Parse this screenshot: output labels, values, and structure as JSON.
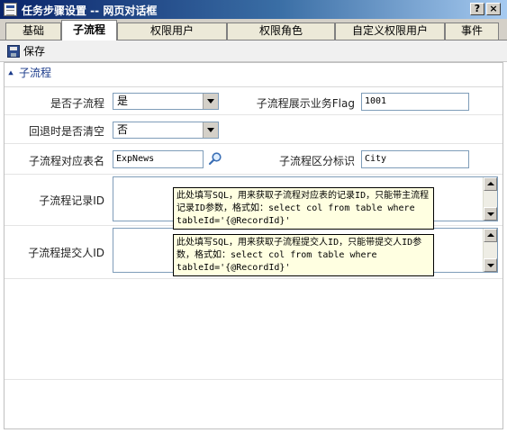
{
  "window": {
    "title": "任务步骤设置 -- 网页对话框",
    "help_label": "?",
    "close_label": "×"
  },
  "tabs": [
    {
      "label": "基础",
      "active": false
    },
    {
      "label": "子流程",
      "active": true
    },
    {
      "label": "权限用户",
      "active": false
    },
    {
      "label": "权限角色",
      "active": false
    },
    {
      "label": "自定义权限用户",
      "active": false
    },
    {
      "label": "事件",
      "active": false
    }
  ],
  "toolbar": {
    "save_label": "保存",
    "save_icon": "save-disk-icon"
  },
  "section": {
    "title": "子流程",
    "collapse_icon": "double-chevron-up-icon"
  },
  "form": {
    "is_subflow_label": "是否子流程",
    "is_subflow_value": "是",
    "display_flag_label": "子流程展示业务Flag",
    "display_flag_value": "1001",
    "clear_on_back_label": "回退时是否清空",
    "clear_on_back_value": "否",
    "table_name_label": "子流程对应表名",
    "table_name_value": "ExpNews",
    "distinguish_label": "子流程区分标识",
    "distinguish_value": "City",
    "record_id_label": "子流程记录ID",
    "submitter_id_label": "子流程提交人ID"
  },
  "tooltips": {
    "record_id_tip": "此处填写SQL，用来获取子流程对应表的记录ID，只能带主流程记录ID参数，格式如：select col from table where tableId='{@RecordId}'",
    "submitter_id_tip": "此处填写SQL，用来获取子流程提交人ID，只能带提交人ID参数，格式如：select col from table where tableId='{@RecordId}'"
  },
  "colors": {
    "titlebar_start": "#0a246a",
    "titlebar_end": "#a6caf0",
    "tooltip_bg": "#ffffe1",
    "section_color": "#1a3a8a",
    "input_border": "#7f9db9"
  }
}
